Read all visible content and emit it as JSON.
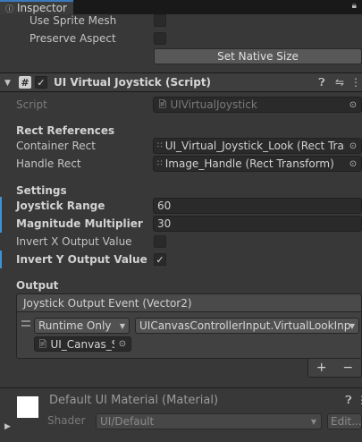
{
  "tab": {
    "title": "Inspector",
    "info_icon": "info-icon",
    "lock_icon": "lock-icon"
  },
  "image_section": {
    "use_sprite_mesh_label": "Use Sprite Mesh",
    "preserve_aspect_label": "Preserve Aspect",
    "set_native_size_label": "Set Native Size"
  },
  "component": {
    "title": "UI Virtual Joystick (Script)",
    "enabled": true,
    "script_label": "Script",
    "script_value": "UIVirtualJoystick",
    "rect_references_header": "Rect References",
    "container_rect_label": "Container Rect",
    "container_rect_value": "UI_Virtual_Joystick_Look (Rect Tran",
    "handle_rect_label": "Handle Rect",
    "handle_rect_value": "Image_Handle (Rect Transform)",
    "settings_header": "Settings",
    "joystick_range_label": "Joystick Range",
    "joystick_range_value": "60",
    "magnitude_multiplier_label": "Magnitude Multiplier",
    "magnitude_multiplier_value": "30",
    "invert_x_label": "Invert X Output Value",
    "invert_x_checked": false,
    "invert_y_label": "Invert Y Output Value",
    "invert_y_checked": true,
    "output_header": "Output",
    "event_title": "Joystick Output Event (Vector2)",
    "event_call_state": "Runtime Only",
    "event_function": "UICanvasControllerInput.VirtualLookInp",
    "event_target": "UI_Canvas_S",
    "add_label": "+",
    "remove_label": "−"
  },
  "material": {
    "title": "Default UI Material (Material)",
    "shader_label": "Shader",
    "shader_value": "UI/Default",
    "edit_label": "Edit..."
  },
  "colors": {
    "background": "#383838",
    "accent": "#3e93d6",
    "field": "#2a2a2a"
  }
}
